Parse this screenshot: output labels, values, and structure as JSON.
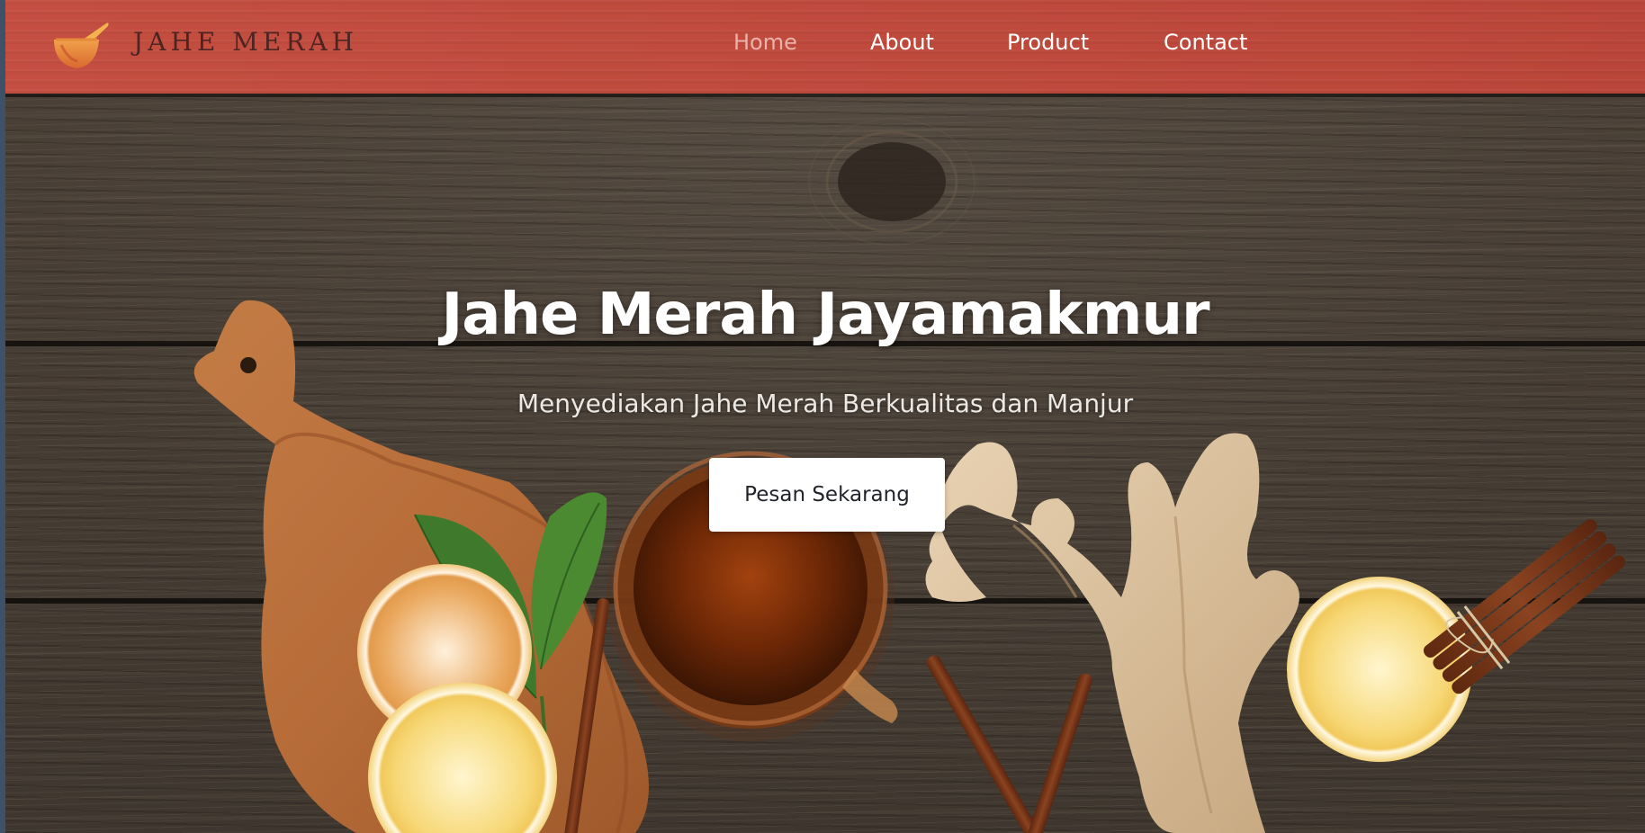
{
  "brand": {
    "name": "JAHE MERAH",
    "logo_icon": "mortar-and-pestle-icon"
  },
  "nav": {
    "items": [
      {
        "label": "Home",
        "active": true
      },
      {
        "label": "About",
        "active": false
      },
      {
        "label": "Product",
        "active": false
      },
      {
        "label": "Contact",
        "active": false
      }
    ]
  },
  "hero": {
    "title": "Jahe Merah Jayamakmur",
    "subtitle": "Menyediakan Jahe Merah Berkualitas dan Manjur",
    "cta_label": "Pesan Sekarang"
  },
  "colors": {
    "navbar_bg": "#c2493b",
    "nav_active": "#eab2aa",
    "nav_text": "#ffffff",
    "brand_text": "#4d2422",
    "wood_dark": "#433a31",
    "cta_bg": "#ffffff",
    "cta_text": "#1f232a"
  },
  "background_illustration": {
    "items": [
      "wood-table-background",
      "cutting-board",
      "tea-leaves",
      "lemon-slice",
      "tea-cup",
      "ginger-root",
      "cinnamon-sticks"
    ]
  }
}
